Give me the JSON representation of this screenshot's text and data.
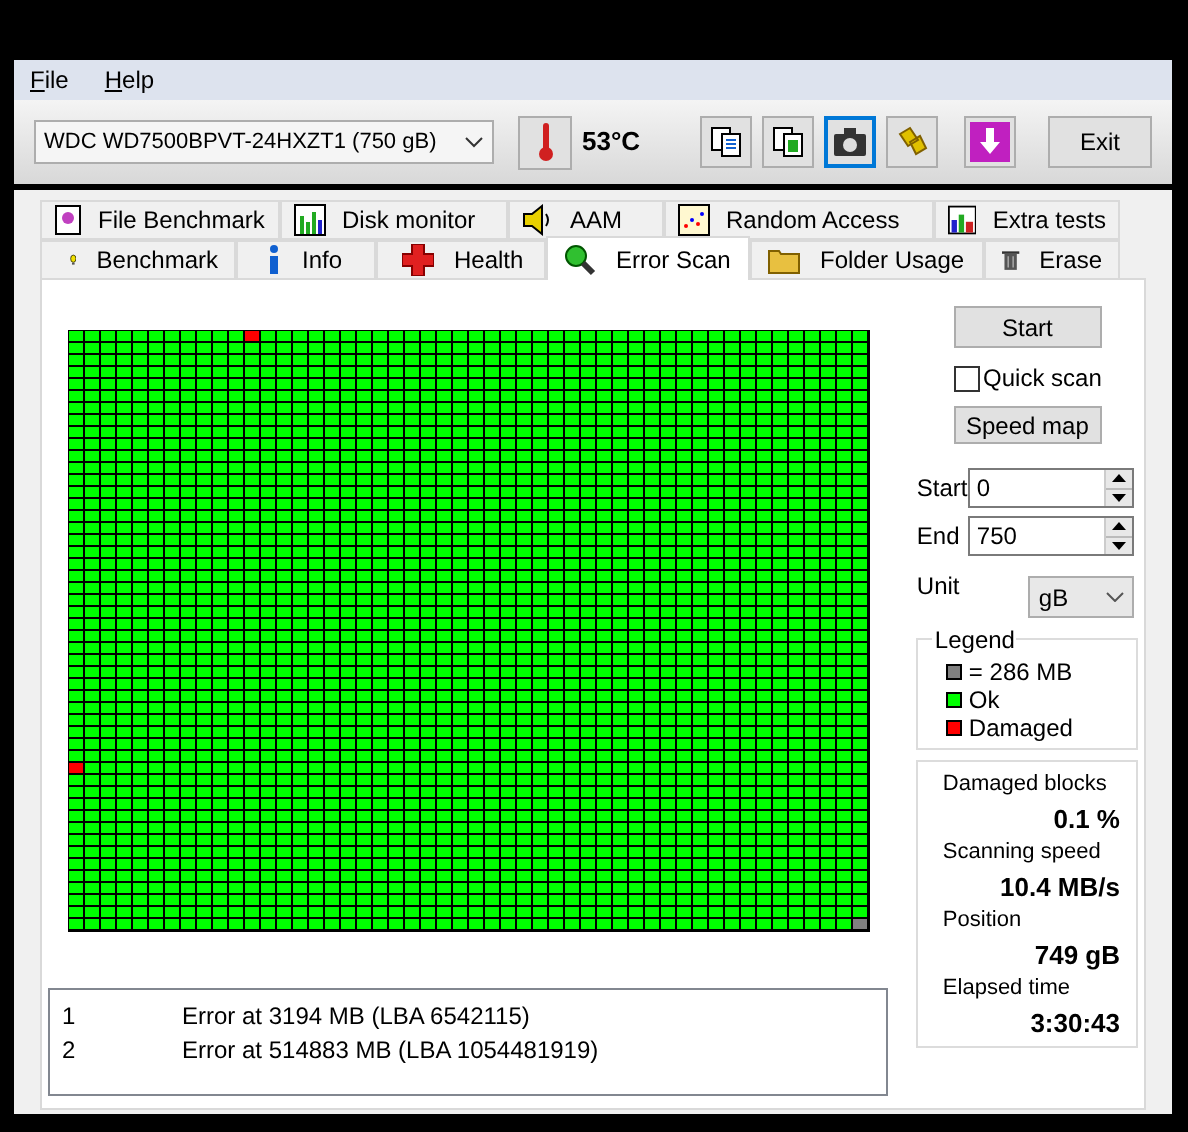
{
  "menu": [
    {
      "label": "File"
    },
    {
      "label": "Help"
    }
  ],
  "toolbar": {
    "drive": "WDC WD7500BPVT-24HXZT1 (750 gB)",
    "temperature": "53°C",
    "tool_buttons": [
      {
        "selected": false
      },
      {
        "selected": false
      },
      {
        "selected": true
      },
      {
        "selected": false
      },
      {
        "selected": false
      }
    ],
    "exit": "Exit"
  },
  "tabs_back": [
    {
      "label": "File Benchmark",
      "selected": false
    },
    {
      "label": "Disk monitor",
      "selected": false
    },
    {
      "label": "AAM",
      "selected": false
    },
    {
      "label": "Random Access",
      "selected": false
    },
    {
      "label": "Extra tests",
      "selected": false
    }
  ],
  "tabs_front": [
    {
      "label": "Benchmark",
      "selected": false
    },
    {
      "label": "Info",
      "selected": false
    },
    {
      "label": "Health",
      "selected": false
    },
    {
      "label": "Error Scan",
      "selected": true
    },
    {
      "label": "Folder Usage",
      "selected": false
    },
    {
      "label": "Erase",
      "selected": false
    }
  ],
  "controls": {
    "start_button": "Start",
    "quick_scan": {
      "label": "Quick scan",
      "checked": false
    },
    "speed_map": "Speed map",
    "start": {
      "label": "Start",
      "value": "0"
    },
    "end": {
      "label": "End",
      "value": "750"
    },
    "unit": {
      "label": "Unit",
      "value": "gB"
    }
  },
  "legend": {
    "title": "Legend",
    "items": [
      {
        "label": "= 286 MB",
        "color": "#808080"
      },
      {
        "label": "Ok",
        "color": "#00ff00"
      },
      {
        "label": "Damaged",
        "color": "#ff0000"
      }
    ]
  },
  "stats": [
    {
      "label": "Damaged blocks",
      "value": "0.1 %"
    },
    {
      "label": "Scanning speed",
      "value": "10.4 MB/s"
    },
    {
      "label": "Position",
      "value": "749 gB"
    },
    {
      "label": "Elapsed time",
      "value": "3:30:43"
    }
  ],
  "errors": [
    {
      "index": "1",
      "message": "Error at 3194 MB (LBA 6542115)"
    },
    {
      "index": "2",
      "message": "Error at 514883 MB (LBA 1054481919)"
    }
  ]
}
